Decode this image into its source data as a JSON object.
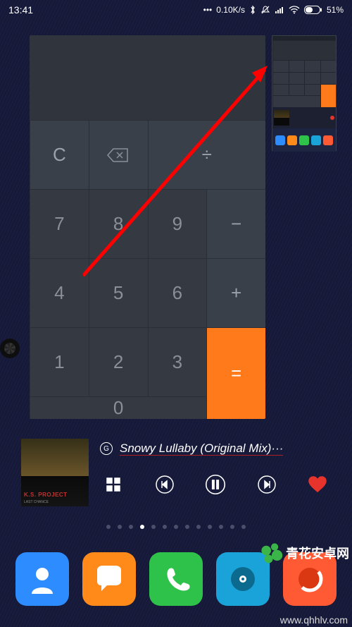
{
  "status": {
    "time": "13:41",
    "dots": "•••",
    "speed": "0.10K/s",
    "battery": "51%"
  },
  "calc": {
    "rows": [
      [
        "C",
        "⌫",
        "÷"
      ],
      [
        "7",
        "8",
        "9",
        "−"
      ],
      [
        "4",
        "5",
        "6",
        "+"
      ],
      [
        "1",
        "2",
        "3",
        "="
      ],
      [
        "0",
        ""
      ]
    ]
  },
  "music": {
    "song": "Snowy Lullaby (Original Mix)···",
    "artist_label": "K.S. PROJECT",
    "artist_sub": "LAST CHANCE"
  },
  "pages": {
    "total": 13,
    "active": 3
  },
  "dock": {
    "apps": [
      {
        "name": "contacts",
        "color": "#2d8cff"
      },
      {
        "name": "messaging",
        "color": "#ff8a1a"
      },
      {
        "name": "phone",
        "color": "#2fc24a"
      },
      {
        "name": "music",
        "color": "#1aa3d9"
      },
      {
        "name": "browser",
        "color": "#ff5a34"
      }
    ]
  },
  "watermark": {
    "brand": "青花安卓网",
    "url": "www.qhhlv.com"
  }
}
